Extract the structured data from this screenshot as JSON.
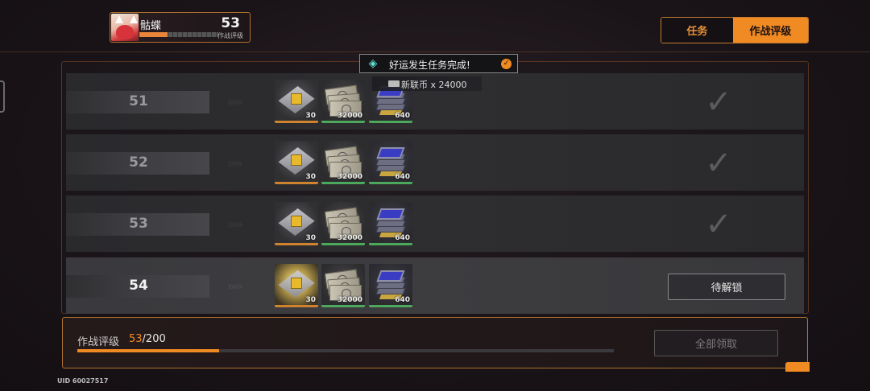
{
  "profile": {
    "name": "骷蝶",
    "level": "53",
    "label": "作战评级",
    "progress": 0.36
  },
  "tabs": [
    {
      "label": "任务",
      "active": false
    },
    {
      "label": "作战评级",
      "active": true
    }
  ],
  "notification": {
    "text": "好运发生任务完成!",
    "reward_text": "新联币 x 24000"
  },
  "rows": [
    {
      "level": "51",
      "status": "claimed",
      "items": [
        {
          "type": "cube",
          "qty": "30"
        },
        {
          "type": "cash",
          "qty": "32000"
        },
        {
          "type": "chip",
          "qty": "640"
        }
      ]
    },
    {
      "level": "52",
      "status": "claimed",
      "items": [
        {
          "type": "cube",
          "qty": "30"
        },
        {
          "type": "cash",
          "qty": "32000"
        },
        {
          "type": "chip",
          "qty": "640"
        }
      ]
    },
    {
      "level": "53",
      "status": "claimed",
      "items": [
        {
          "type": "cube",
          "qty": "30"
        },
        {
          "type": "cash",
          "qty": "32000"
        },
        {
          "type": "chip",
          "qty": "640"
        }
      ]
    },
    {
      "level": "54",
      "status": "locked",
      "action_label": "待解锁",
      "items": [
        {
          "type": "cube",
          "qty": "30"
        },
        {
          "type": "cash",
          "qty": "32000"
        },
        {
          "type": "chip",
          "qty": "640"
        }
      ]
    }
  ],
  "bottom": {
    "label": "作战评级",
    "current": "53",
    "max": "/200",
    "progress": 0.265,
    "claim_all_label": "全部领取"
  },
  "uid": "UID 60027517",
  "colors": {
    "accent": "#f08a22",
    "border": "#b0702e",
    "claimed_check": "#5c5c60"
  }
}
